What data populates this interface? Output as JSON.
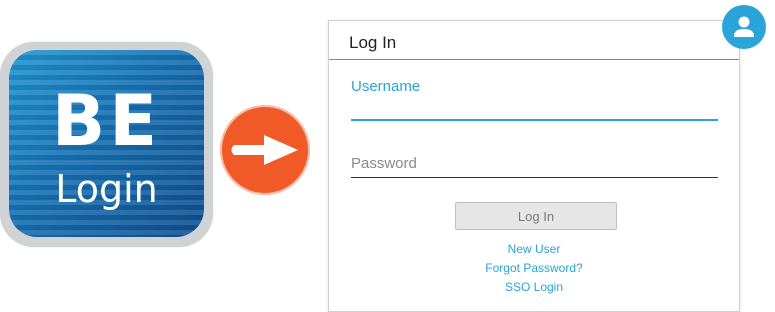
{
  "app_icon": {
    "line1": "BE",
    "line2": "Login",
    "colors": {
      "tile_border": "#cfd3d6",
      "tile_blue": "#1670b3"
    }
  },
  "arrow": {
    "icon": "arrow-right-icon",
    "color": "#f05a28"
  },
  "login_card": {
    "title": "Log In",
    "username_label": "Username",
    "username_value": "",
    "password_placeholder": "Password",
    "login_button": "Log In",
    "links": {
      "new_user": "New User",
      "forgot_password": "Forgot Password?",
      "sso_login": "SSO Login"
    },
    "accent_color": "#2aa4d9"
  },
  "avatar": {
    "icon": "user-icon",
    "color": "#2aa4d9"
  }
}
